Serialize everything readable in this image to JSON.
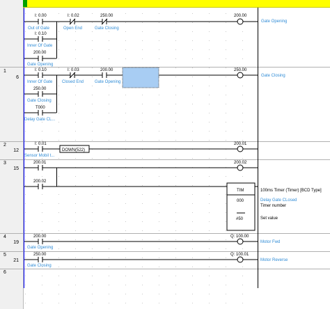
{
  "rungs": [
    {
      "num": "",
      "addr": ""
    },
    {
      "num": "1",
      "addr": "6"
    },
    {
      "num": "2",
      "addr": "12"
    },
    {
      "num": "3",
      "addr": "15"
    },
    {
      "num": "4",
      "addr": "19"
    },
    {
      "num": "5",
      "addr": "21"
    },
    {
      "num": "6",
      "addr": ""
    }
  ],
  "r0": {
    "c1_addr": "I: 0.00",
    "c1_label": "Out of Gate",
    "c2_addr": "I: 0.02",
    "c2_label": "Open End",
    "c3_addr": "250.00",
    "c3_label": "Gate Closing",
    "b1_addr": "I: 0.10",
    "b1_label": "Inner Of Gate",
    "b2_addr": "200.00",
    "b2_label": "Gate Opening",
    "coil_addr": "200.00",
    "coil_label": "Gate Opening"
  },
  "r1": {
    "c1_addr": "I: 0.10",
    "c1_label": "Inner Of Gate",
    "c2_addr": "I: 0.03",
    "c2_label": "Closed End",
    "c3_addr": "200.00",
    "c3_label": "Gate Opening",
    "b1_addr": "250.00",
    "b1_label": "Gate Closing",
    "b2_addr": "T000",
    "b2_label": "Delay Gate CL...",
    "coil_addr": "250.00",
    "coil_label": "Gate Closing"
  },
  "r2": {
    "c1_addr": "I: 0.01",
    "c1_label": "Sensor Mobil t...",
    "func": "DOWN(522)",
    "coil_addr": "200.01"
  },
  "r3": {
    "c1_addr": "200.01",
    "b1_addr": "200.02",
    "coil_addr": "200.02",
    "tim_title": "TIM",
    "tim_num": "000",
    "tim_set": "#50",
    "tim_desc": "100ms Timer (Timer) [BCD Type]",
    "tim_comment": "Delay Gate CLosed",
    "tim_num_label": "Timer number",
    "tim_set_label": "Set value"
  },
  "r4": {
    "c1_addr": "200.00",
    "c1_label": "Gate Opening",
    "coil_addr": "Q: 100.00",
    "coil_label": "Motor Fwd"
  },
  "r5": {
    "c1_addr": "250.00",
    "c1_label": "Gate Closing",
    "coil_addr": "Q: 100.01",
    "coil_label": "Motor Reverse"
  },
  "colors": {
    "topbar": "#ffff00",
    "rail_left": "#0000ff",
    "rail_right": "#000000",
    "selection": "#a8cdf3",
    "symbol_label": "#2e8bd6"
  }
}
